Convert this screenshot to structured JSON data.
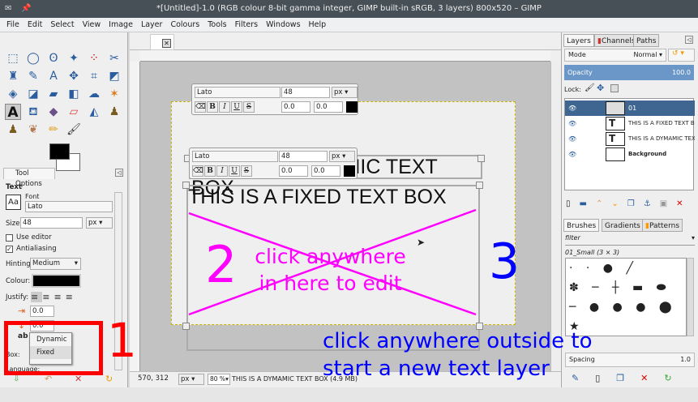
{
  "window": {
    "title": "*[Untitled]-1.0 (RGB colour 8-bit gamma integer, GIMP built-in sRGB, 3 layers) 800x520 – GIMP"
  },
  "menu": [
    "File",
    "Edit",
    "Select",
    "View",
    "Image",
    "Layer",
    "Colours",
    "Tools",
    "Filters",
    "Windows",
    "Help"
  ],
  "tool_options": {
    "tab": "Tool Options",
    "section": "Text",
    "font_label": "Font",
    "font": "Lato",
    "size_label": "Size:",
    "size": "48",
    "unit": "px",
    "use_editor": "Use editor",
    "antialiasing": "Antialiasing",
    "hinting_label": "Hinting:",
    "hinting": "Medium",
    "colour_label": "Colour:",
    "justify_label": "Justify:",
    "indent": "0.0",
    "line_spacing": "0.0",
    "box_label": "Box:",
    "box_options": [
      "Dynamic",
      "Fixed"
    ],
    "language_label": "Language:"
  },
  "text_toolbar": {
    "font": "Lato",
    "size": "48",
    "unit": "px",
    "baseline": "0.0",
    "kerning": "0.0",
    "bold": "B",
    "italic": "I",
    "underline": "U",
    "strike": "S"
  },
  "canvas": {
    "dynamic_text": "THIS IS A DYMAMIC TEXT BOX",
    "fixed_text": "THIS IS A FIXED TEXT BOX"
  },
  "status": {
    "coords": "570, 312",
    "unit": "px",
    "zoom": "80 %",
    "message": "THIS IS A DYMAMIC TEXT BOX (4.9 MB)"
  },
  "layers_panel": {
    "tabs": [
      "Layers",
      "Channels",
      "Paths"
    ],
    "mode_label": "Mode",
    "mode": "Normal",
    "opacity_label": "Opacity",
    "opacity": "100.0",
    "lock_label": "Lock:",
    "layers": [
      {
        "name": "01",
        "selected": true
      },
      {
        "name": "THIS IS A FIXED TEXT BOX"
      },
      {
        "name": "THIS IS A DYMAMIC TEXT BOX"
      },
      {
        "name": "Background"
      }
    ]
  },
  "brushes_panel": {
    "tabs": [
      "Brushes",
      "Gradients",
      "Patterns"
    ],
    "filter": "filter",
    "brush": "01_Small (3 × 3)",
    "spacing_label": "Spacing",
    "spacing": "1.0"
  },
  "annotations": {
    "one": "1",
    "two": "2",
    "three": "3",
    "inside": "click anywhere in here to edit",
    "outside": "click anywhere outside to start a new text layer",
    "color_red": "#ff0000",
    "color_magenta": "#ff00ff",
    "color_blue": "#0000ff"
  }
}
